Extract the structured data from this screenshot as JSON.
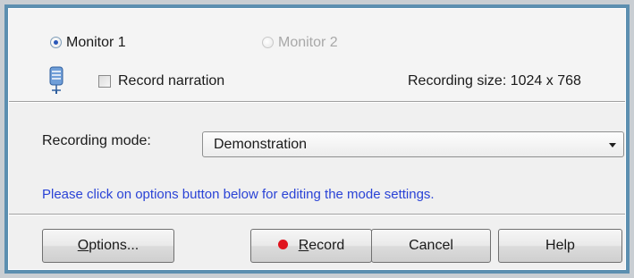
{
  "monitors": {
    "monitor1_label": "Monitor 1",
    "monitor2_label": "Monitor 2",
    "selected": "Monitor 1"
  },
  "narration": {
    "label": "Record narration",
    "checked": false
  },
  "recording_size": "Recording size: 1024 x 768",
  "mode": {
    "label": "Recording mode:",
    "value": "Demonstration"
  },
  "hint": "Please click on options button below for editing the mode settings.",
  "buttons": {
    "options_prefix": "O",
    "options_rest": "ptions...",
    "record_prefix": "R",
    "record_rest": "ecord",
    "cancel": "Cancel",
    "help": "Help"
  },
  "colors": {
    "frame": "#5c8fb0",
    "hint_text": "#2a43d6",
    "record_dot": "#e0141e"
  },
  "icons": {
    "mic": "microphone-icon"
  }
}
